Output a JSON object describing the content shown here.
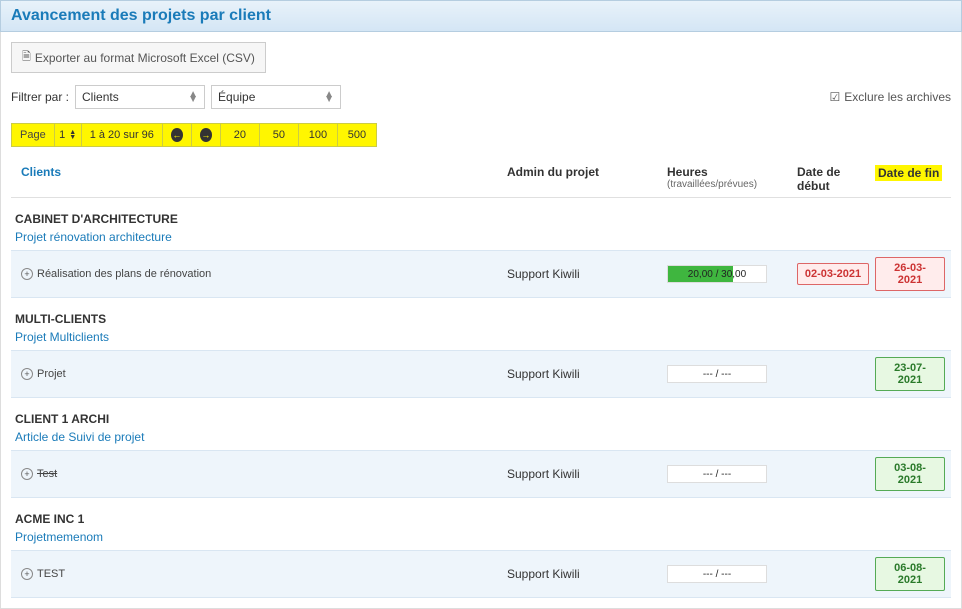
{
  "header": {
    "title": "Avancement des projets par client"
  },
  "export": {
    "label": "Exporter au format Microsoft Excel (CSV)"
  },
  "filter": {
    "label": "Filtrer par :",
    "clients": "Clients",
    "equipe": "Équipe"
  },
  "archive": {
    "label": "Exclure les archives",
    "checked": true
  },
  "pager": {
    "page_label": "Page",
    "page_num": "1",
    "range": "1 à 20 sur 96",
    "sizes": [
      "20",
      "50",
      "100",
      "500"
    ]
  },
  "columns": {
    "clients": "Clients",
    "admin": "Admin du projet",
    "hours": "Heures",
    "hours_sub": "(travaillées/prévues)",
    "start": "Date de début",
    "end": "Date de fin"
  },
  "groups": [
    {
      "client": "CABINET D'ARCHITECTURE",
      "project": "Projet rénovation architecture",
      "task": "Réalisation des plans de rénovation",
      "task_strike": false,
      "admin": "Support Kiwili",
      "hours_worked": "20,00",
      "hours_planned": "30,00",
      "hours_pct": 66,
      "start": "02-03-2021",
      "start_variant": "red",
      "end": "26-03-2021",
      "end_variant": "red"
    },
    {
      "client": "MULTI-CLIENTS",
      "project": "Projet Multiclients",
      "task": "Projet",
      "task_strike": false,
      "admin": "Support Kiwili",
      "hours_none": "--- / ---",
      "end": "23-07-2021",
      "end_variant": "green"
    },
    {
      "client": "CLIENT 1 ARCHI",
      "project": "Article de Suivi de projet",
      "task": "Test",
      "task_strike": true,
      "admin": "Support Kiwili",
      "hours_none": "--- / ---",
      "end": "03-08-2021",
      "end_variant": "green"
    },
    {
      "client": "ACME INC 1",
      "project": "Projetmemenom",
      "task": "TEST",
      "task_strike": false,
      "admin": "Support Kiwili",
      "hours_none": "--- / ---",
      "end": "06-08-2021",
      "end_variant": "green"
    }
  ]
}
